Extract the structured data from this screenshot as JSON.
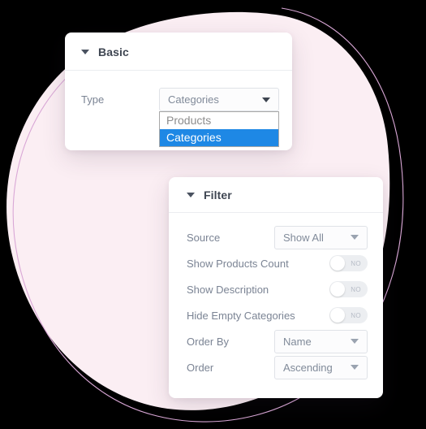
{
  "theme": {
    "page_background": "#000000",
    "blob_fill": "#fbeef3",
    "outline_stroke": "#d9a7d6",
    "card_background": "#ffffff",
    "accent_highlight": "#1e88e5",
    "label_color": "#7b8494",
    "title_color": "#3f4652"
  },
  "panels": {
    "basic": {
      "title": "Basic",
      "caret_icon": "caret-down-icon",
      "type_row": {
        "label": "Type",
        "selected_value": "Categories",
        "arrow_icon": "chevron-down-icon",
        "open": true,
        "options": [
          {
            "label": "Products",
            "selected": false
          },
          {
            "label": "Categories",
            "selected": true
          }
        ]
      }
    },
    "filter": {
      "title": "Filter",
      "caret_icon": "caret-down-icon",
      "rows": [
        {
          "kind": "select",
          "label": "Source",
          "value": "Show All",
          "arrow_icon": "chevron-down-icon"
        },
        {
          "kind": "toggle",
          "label": "Show Products Count",
          "state": "NO",
          "on": false
        },
        {
          "kind": "toggle",
          "label": "Show Description",
          "state": "NO",
          "on": false
        },
        {
          "kind": "toggle",
          "label": "Hide Empty Categories",
          "state": "NO",
          "on": false
        },
        {
          "kind": "select",
          "label": "Order By",
          "value": "Name",
          "arrow_icon": "chevron-down-icon"
        },
        {
          "kind": "select",
          "label": "Order",
          "value": "Ascending",
          "arrow_icon": "chevron-down-icon"
        }
      ]
    }
  }
}
